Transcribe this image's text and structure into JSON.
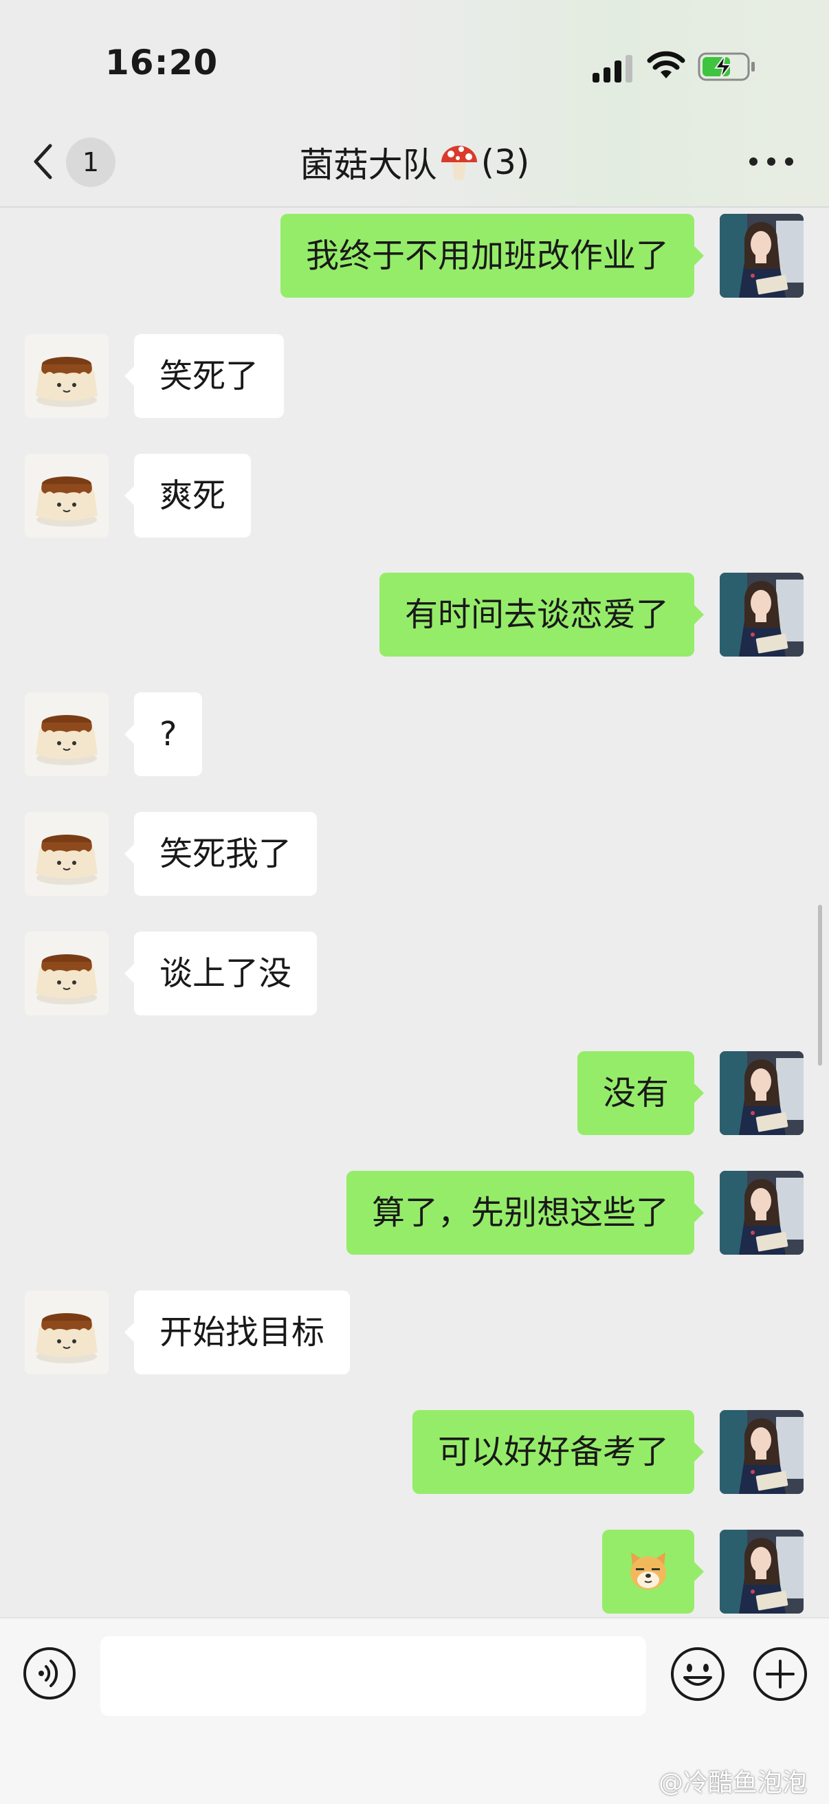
{
  "status_bar": {
    "time": "16:20"
  },
  "header": {
    "back_count": "1",
    "title_before": "菌菇大队",
    "title_after": "(3)",
    "title_icon": "mushroom-icon"
  },
  "messages": [
    {
      "side": "right",
      "text": "我终于不用加班改作业了"
    },
    {
      "side": "left",
      "text": "笑死了"
    },
    {
      "side": "left",
      "text": "爽死"
    },
    {
      "side": "right",
      "text": "有时间去谈恋爱了"
    },
    {
      "side": "left",
      "text": "?"
    },
    {
      "side": "left",
      "text": "笑死我了"
    },
    {
      "side": "left",
      "text": "谈上了没"
    },
    {
      "side": "right",
      "text": "没有"
    },
    {
      "side": "right",
      "text": "算了，先别想这些了"
    },
    {
      "side": "left",
      "text": "开始找目标"
    },
    {
      "side": "right",
      "text": "可以好好备考了"
    },
    {
      "side": "right",
      "text": "",
      "sticker": "doge-emoji"
    }
  ],
  "input_bar": {
    "voice": "voice-icon",
    "emoji": "smiley-icon",
    "more": "plus-icon"
  },
  "watermark": "@冷酷鱼泡泡",
  "colors": {
    "bubble_sent": "#95ec69",
    "bubble_received": "#ffffff",
    "background": "#ededed"
  }
}
